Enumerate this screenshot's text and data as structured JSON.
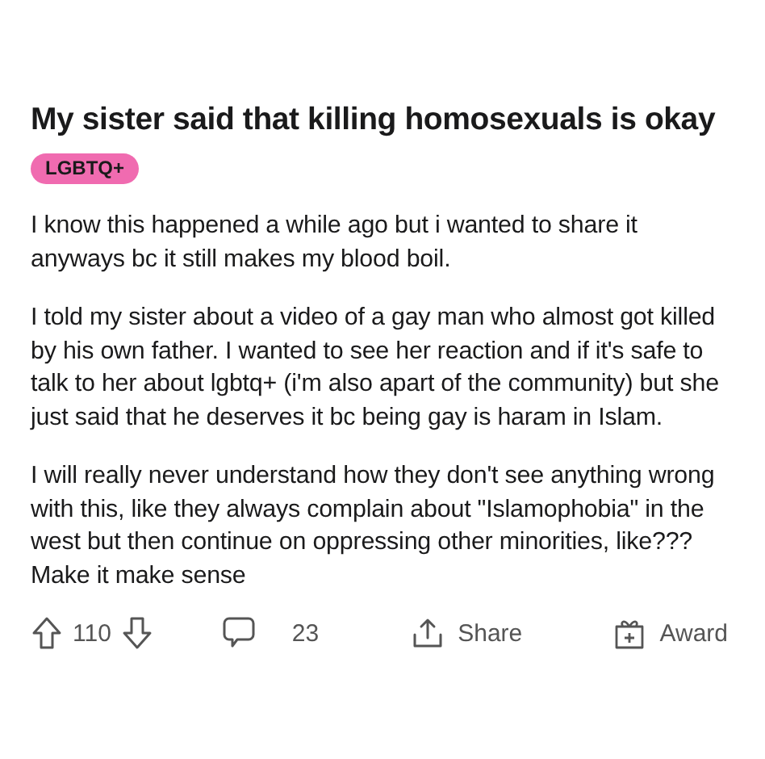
{
  "post": {
    "title": "My sister said that killing homosexuals is okay",
    "flair": {
      "label": "LGBTQ+",
      "color": "#f06bb0"
    },
    "paragraphs": [
      "I know this happened a while ago but i wanted to share it anyways bc it still makes my blood boil.",
      "I told my sister about a video of a gay man who almost got killed by his own father. I wanted to see her reaction and if it's safe to talk to her about lgbtq+ (i'm also apart of the community) but she just said that he deserves it bc being gay is haram in Islam.",
      "I will really never understand how they don't see anything wrong with this, like they always complain about \"Islamophobia\" in the west but then continue on oppressing other minorities, like??? Make it make sense"
    ]
  },
  "actions": {
    "score": "110",
    "comments": "23",
    "share": "Share",
    "award": "Award"
  }
}
